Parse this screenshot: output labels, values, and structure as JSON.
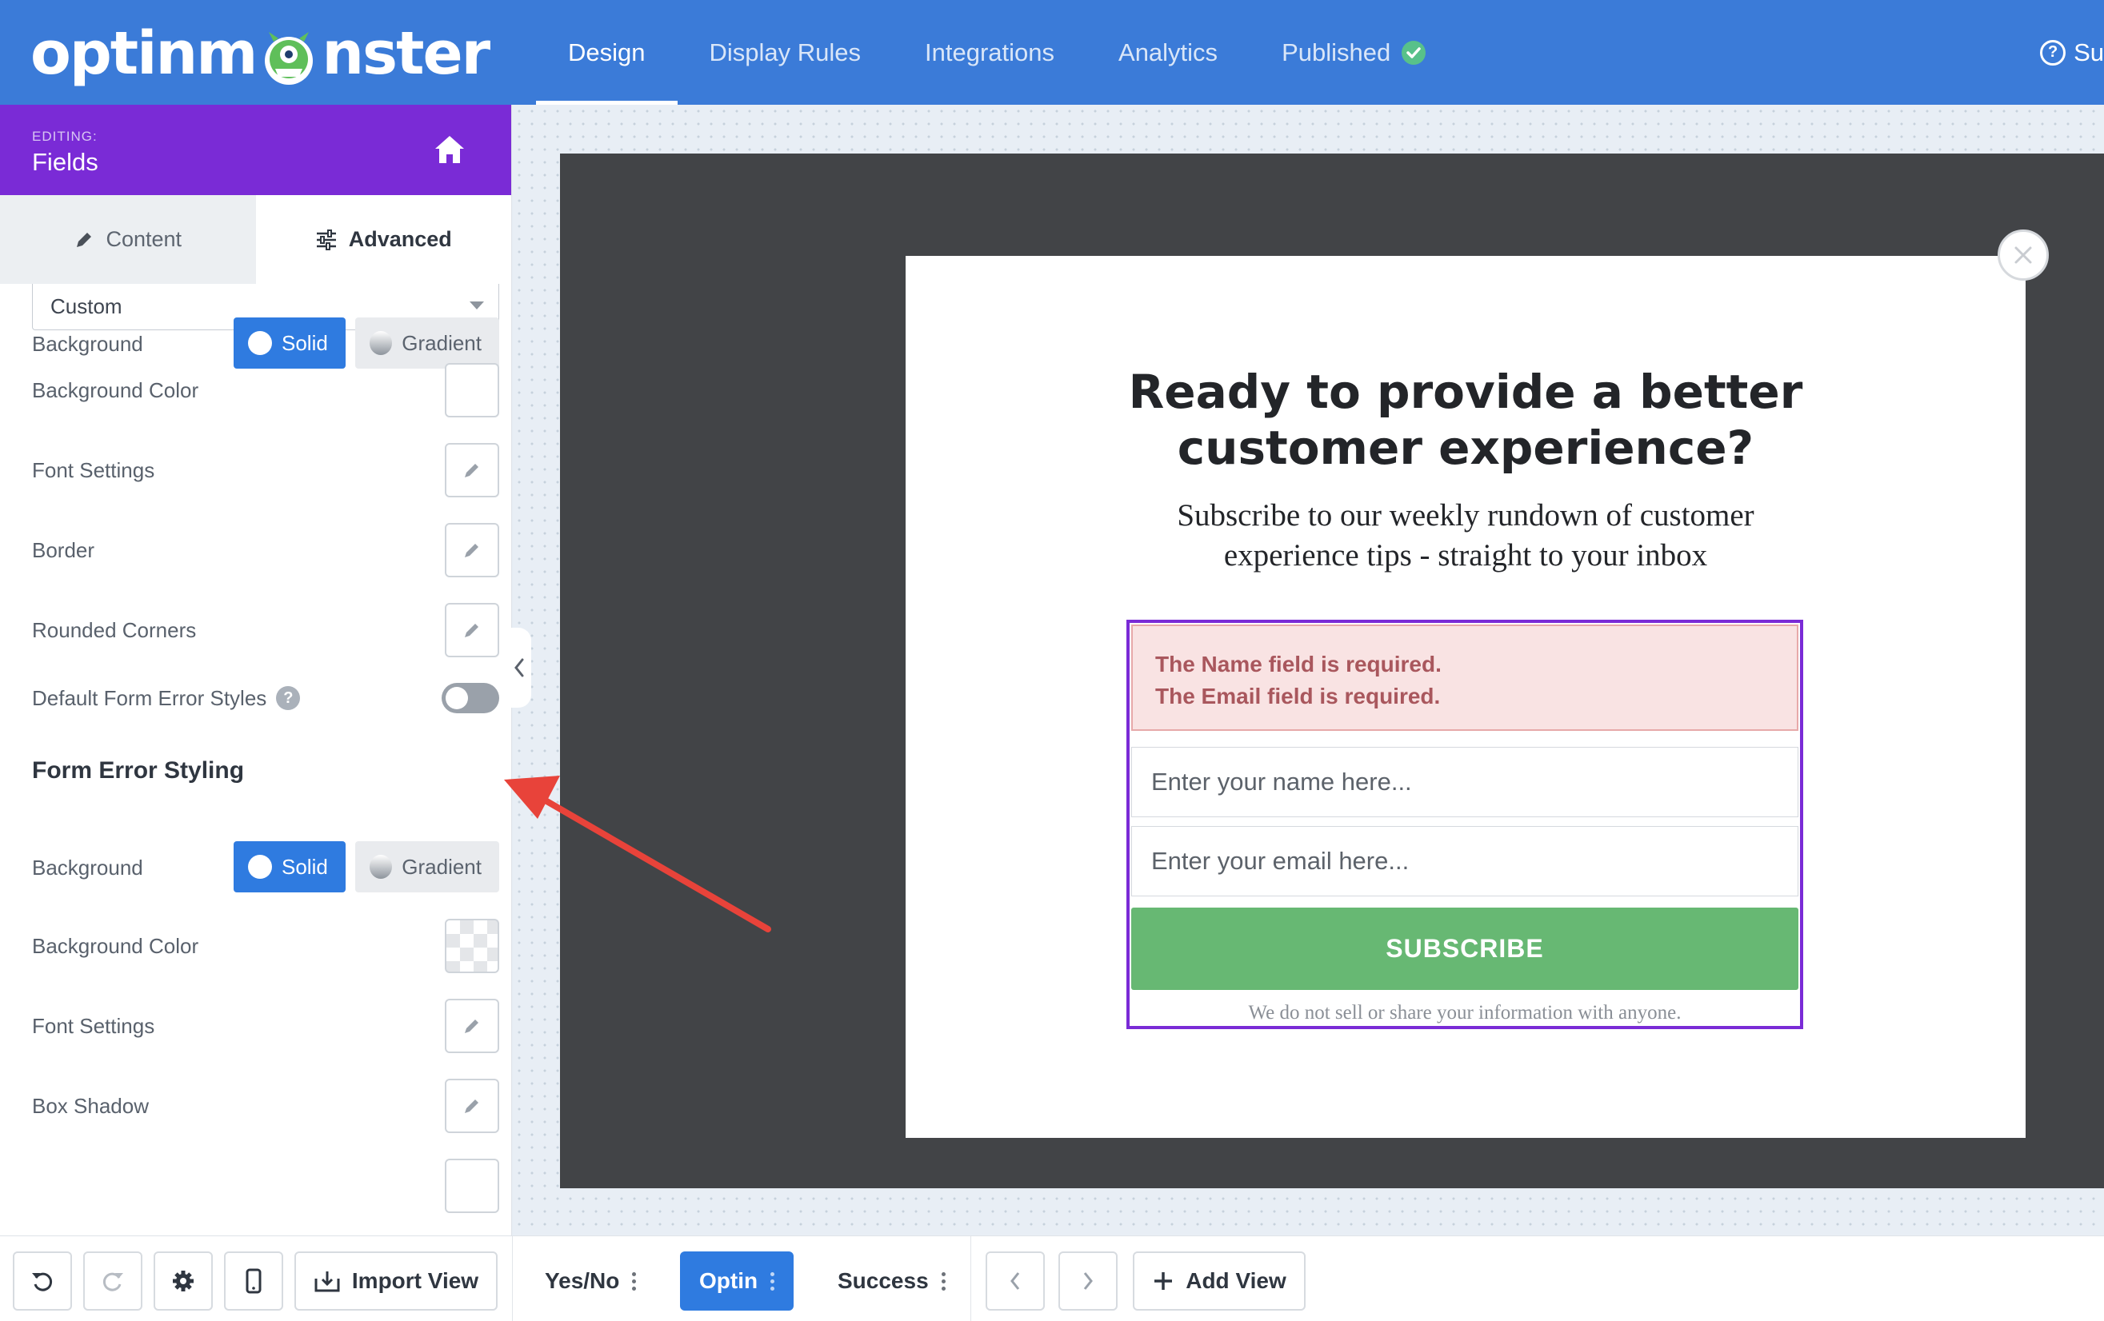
{
  "app": {
    "logo_text_left": "optinm",
    "logo_text_right": "nster"
  },
  "nav": {
    "items": [
      {
        "label": "Design",
        "active": true
      },
      {
        "label": "Display Rules",
        "active": false
      },
      {
        "label": "Integrations",
        "active": false
      },
      {
        "label": "Analytics",
        "active": false
      },
      {
        "label": "Published",
        "active": false
      }
    ],
    "help_label": "Su"
  },
  "sidebar": {
    "editing_label": "EDITING:",
    "editing_name": "Fields",
    "tabs": [
      {
        "label": "Content",
        "active": false
      },
      {
        "label": "Advanced",
        "active": true
      }
    ],
    "select_value": "Custom",
    "fields_section": {
      "background_label": "Background",
      "solid_label": "Solid",
      "gradient_label": "Gradient",
      "background_color_label": "Background Color",
      "font_settings_label": "Font Settings",
      "border_label": "Border",
      "rounded_corners_label": "Rounded Corners",
      "default_error_styles_label": "Default Form Error Styles",
      "default_error_styles_on": false
    },
    "form_error_section": {
      "title": "Form Error Styling",
      "background_label": "Background",
      "solid_label": "Solid",
      "gradient_label": "Gradient",
      "background_color_label": "Background Color",
      "font_settings_label": "Font Settings",
      "box_shadow_label": "Box Shadow"
    }
  },
  "bottombar": {
    "import_view_label": "Import View",
    "views": [
      {
        "label": "Yes/No",
        "active": false
      },
      {
        "label": "Optin",
        "active": true
      },
      {
        "label": "Success",
        "active": false
      }
    ],
    "add_view_label": "Add View"
  },
  "popup": {
    "headline_line1": "Ready to provide a better",
    "headline_line2": "customer experience?",
    "subline_line1": "Subscribe to our weekly rundown of customer",
    "subline_line2": "experience tips - straight to your inbox",
    "errors": [
      "The Name field is required.",
      "The Email field is required."
    ],
    "name_placeholder": "Enter your name here...",
    "email_placeholder": "Enter your email here...",
    "subscribe_label": "SUBSCRIBE",
    "privacy_text": "We do not sell or share your information with anyone."
  },
  "colors": {
    "topbar": "#3b7bd8",
    "editing_header": "#7a2bd6",
    "primary_button": "#2f7be0",
    "subscribe_button": "#67b873",
    "error_background": "#f9e3e3",
    "error_text": "#a9575d",
    "annotation_arrow": "#e8433a"
  }
}
